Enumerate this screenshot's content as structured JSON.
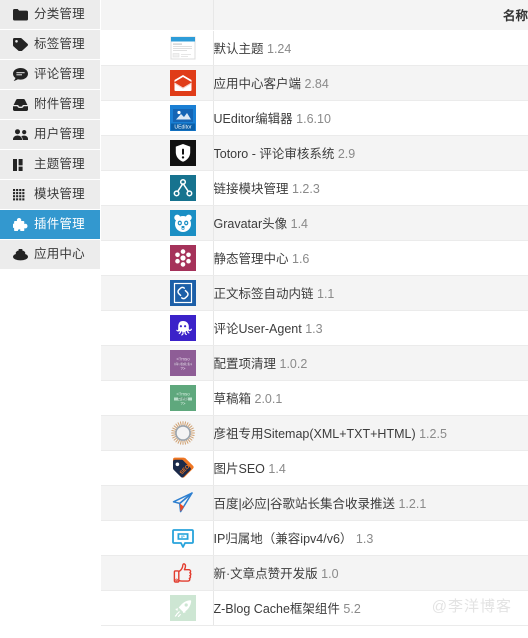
{
  "sidebar": {
    "items": [
      {
        "label": "分类管理",
        "icon": "folder-icon",
        "active": false
      },
      {
        "label": "标签管理",
        "icon": "tag-icon",
        "active": false
      },
      {
        "label": "评论管理",
        "icon": "comment-icon",
        "active": false
      },
      {
        "label": "附件管理",
        "icon": "inbox-icon",
        "active": false
      },
      {
        "label": "用户管理",
        "icon": "users-icon",
        "active": false
      },
      {
        "label": "主题管理",
        "icon": "columns-icon",
        "active": false
      },
      {
        "label": "模块管理",
        "icon": "grid-icon",
        "active": false
      },
      {
        "label": "插件管理",
        "icon": "puzzle-icon",
        "active": true
      },
      {
        "label": "应用中心",
        "icon": "briefcase-icon",
        "active": false
      }
    ]
  },
  "table": {
    "headers": {
      "check": "",
      "icon": "",
      "name": "名称"
    },
    "rows": [
      {
        "name": "默认主题",
        "version": "1.24",
        "icon": "default-theme-icon"
      },
      {
        "name": "应用中心客户端",
        "version": "2.84",
        "icon": "appcenter-client-icon"
      },
      {
        "name": "UEditor编辑器",
        "version": "1.6.10",
        "icon": "ueditor-icon"
      },
      {
        "name": "Totoro - 评论审核系统",
        "version": "2.9",
        "icon": "totoro-shield-icon"
      },
      {
        "name": "链接模块管理",
        "version": "1.2.3",
        "icon": "link-module-icon"
      },
      {
        "name": "Gravatar头像",
        "version": "1.4",
        "icon": "gravatar-panda-icon"
      },
      {
        "name": "静态管理中心",
        "version": "1.6",
        "icon": "static-center-icon"
      },
      {
        "name": "正文标签自动内链",
        "version": "1.1",
        "icon": "auto-inlink-icon"
      },
      {
        "name": "评论User-Agent",
        "version": "1.3",
        "icon": "user-agent-octopus-icon"
      },
      {
        "name": "配置项清理",
        "version": "1.0.2",
        "icon": "config-clean-icon"
      },
      {
        "name": "草稿箱",
        "version": "2.0.1",
        "icon": "draftbox-icon"
      },
      {
        "name": "彦祖专用Sitemap(XML+TXT+HTML)",
        "version": "1.2.5",
        "icon": "sitemap-sun-icon"
      },
      {
        "name": "图片SEO",
        "version": "1.4",
        "icon": "seo-tag-icon"
      },
      {
        "name": "百度|必应|谷歌站长集合收录推送",
        "version": "1.2.1",
        "icon": "push-paperplane-icon"
      },
      {
        "name": "IP归属地（兼容ipv4/v6）",
        "version": "1.3",
        "icon": "ip-location-icon"
      },
      {
        "name": "新·文章点赞开发版",
        "version": "1.0",
        "icon": "thumbs-up-icon"
      },
      {
        "name": "Z-Blog Cache框架组件",
        "version": "5.2",
        "icon": "rocket-cache-icon"
      }
    ]
  },
  "watermark": {
    "text": "@李洋博客"
  },
  "colors": {
    "sidebar_item_bg": "#ececec",
    "sidebar_active_bg": "#3398cf",
    "row_alt_bg": "#f4f4f4",
    "header_bg": "#f4f4f4",
    "text": "#3c3c3c",
    "version_text": "#8a8a8a",
    "watermark": "#e3e3e3"
  }
}
